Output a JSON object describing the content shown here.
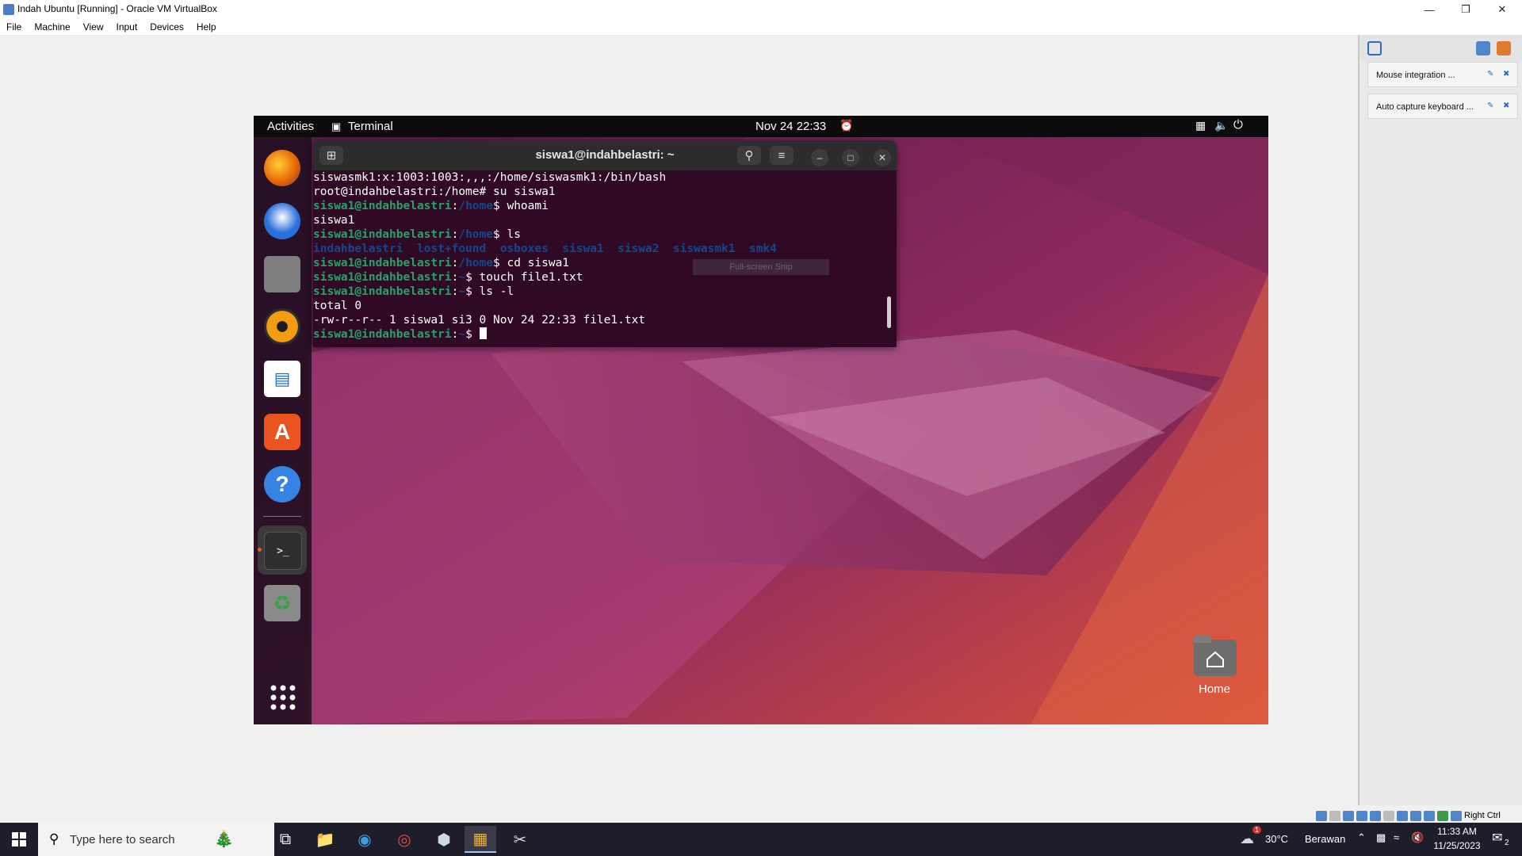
{
  "window": {
    "title": "Indah Ubuntu [Running] - Oracle VM VirtualBox"
  },
  "menu": [
    "File",
    "Machine",
    "View",
    "Input",
    "Devices",
    "Help"
  ],
  "side_panel": {
    "notices": [
      {
        "label": "Mouse integration ..."
      },
      {
        "label": "Auto capture keyboard ..."
      }
    ]
  },
  "vbox_status": {
    "host_key": "Right Ctrl"
  },
  "guest": {
    "topbar": {
      "activities": "Activities",
      "app": "Terminal",
      "clock": "Nov 24  22:33"
    },
    "dock": [
      {
        "name": "firefox",
        "color": "#e66000"
      },
      {
        "name": "thunderbird",
        "color": "#2a6fdb"
      },
      {
        "name": "files",
        "color": "#8a8a8a"
      },
      {
        "name": "rhythmbox",
        "color": "#f39c12"
      },
      {
        "name": "libreoffice-writer",
        "color": "#1f6fc5"
      },
      {
        "name": "app-center",
        "color": "#e95420"
      },
      {
        "name": "help",
        "color": "#3584e4"
      },
      {
        "name": "terminal",
        "color": "#2e2e2e"
      },
      {
        "name": "trash",
        "color": "#8a8a8a"
      }
    ],
    "terminal": {
      "title": "siswa1@indahbelastri: ~",
      "lines": [
        {
          "plain": "siswasmk1:x:1003:1003:,,,:/home/siswasmk1:/bin/bash"
        },
        {
          "plain": "root@indahbelastri:/home# su siswa1"
        },
        {
          "user": "siswa1@indahbelastri",
          "path": "/home",
          "cmd": "$ whoami"
        },
        {
          "plain": "siswa1"
        },
        {
          "user": "siswa1@indahbelastri",
          "path": "/home",
          "cmd": "$ ls"
        },
        {
          "dirs": "indahbelastri  lost+found  osboxes  siswa1  siswa2  siswasmk1  smk4"
        },
        {
          "user": "siswa1@indahbelastri",
          "path": "/home",
          "cmd": "$ cd siswa1"
        },
        {
          "user": "siswa1@indahbelastri",
          "path": "~",
          "cmd": "$ touch file1.txt"
        },
        {
          "user": "siswa1@indahbelastri",
          "path": "~",
          "cmd": "$ ls -l"
        },
        {
          "plain": "total 0"
        },
        {
          "plain": "-rw-r--r-- 1 siswa1 si3 0 Nov 24 22:33 file1.txt"
        },
        {
          "user": "siswa1@indahbelastri",
          "path": "~",
          "cmd": "$ ",
          "cursor": true
        }
      ]
    },
    "snip_overlay": "Full-screen Snip",
    "desktop_icon": "Home"
  },
  "taskbar": {
    "search_placeholder": "Type here to search",
    "weather_temp": "30°C",
    "weather_desc": "Berawan",
    "weather_badge": "1",
    "time": "11:33 AM",
    "date": "11/25/2023",
    "notif_count": "2"
  }
}
